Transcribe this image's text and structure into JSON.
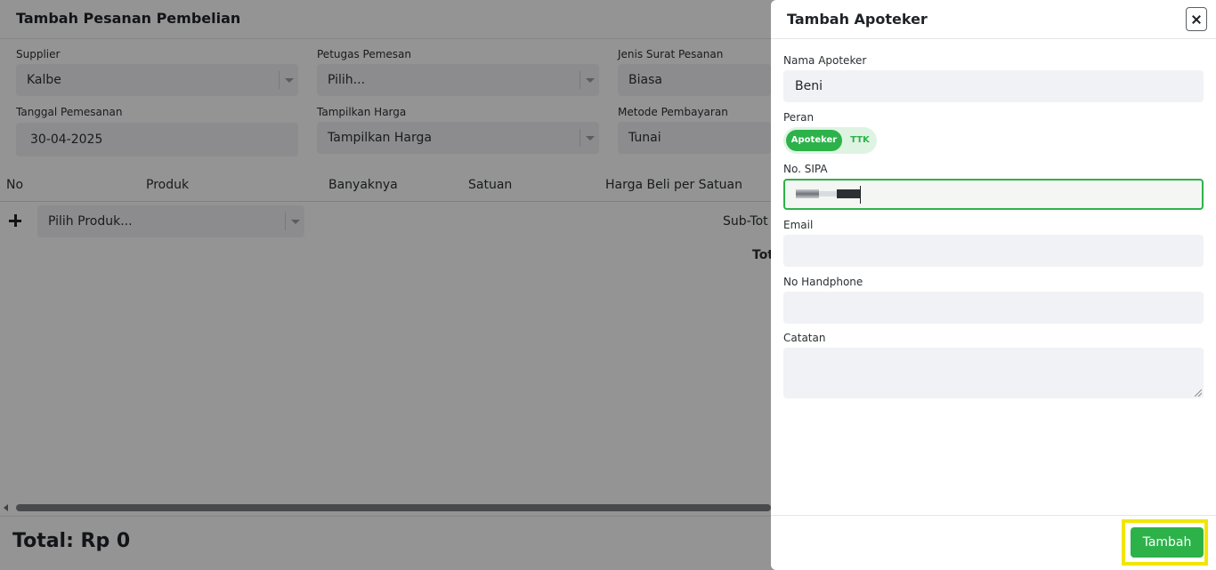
{
  "background": {
    "title": "Tambah Pesanan Pembelian",
    "fields": [
      {
        "label": "Supplier",
        "value": "Kalbe"
      },
      {
        "label": "Petugas Pemesan",
        "value": "Pilih..."
      },
      {
        "label": "Jenis Surat Pesanan",
        "value": "Biasa"
      },
      {
        "label": "Tanggal Pemesanan",
        "value": "30-04-2025"
      },
      {
        "label": "Tampilkan Harga",
        "value": "Tampilkan Harga"
      },
      {
        "label": "Metode Pembayaran",
        "value": "Tunai"
      }
    ],
    "table": {
      "columns": [
        "No",
        "Produk",
        "Banyaknya",
        "Satuan",
        "Harga Beli per Satuan"
      ],
      "product_select_placeholder": "Pilih Produk...",
      "subtotal_label": "Sub-Tot",
      "total_label": "Tot"
    },
    "grand_total": "Total: Rp 0"
  },
  "drawer": {
    "title": "Tambah Apoteker",
    "fields": {
      "nama_label": "Nama Apoteker",
      "nama_value": "Beni",
      "peran_label": "Peran",
      "peran_options": [
        "Apoteker",
        "TTK"
      ],
      "peran_selected": "Apoteker",
      "sipa_label": "No. SIPA",
      "email_label": "Email",
      "email_value": "",
      "hp_label": "No Handphone",
      "hp_value": "",
      "catatan_label": "Catatan"
    },
    "submit_label": "Tambah"
  },
  "colors": {
    "accent": "#2db24a",
    "highlight": "#f2e600",
    "overlay": "rgba(0,0,0,0.42)"
  }
}
